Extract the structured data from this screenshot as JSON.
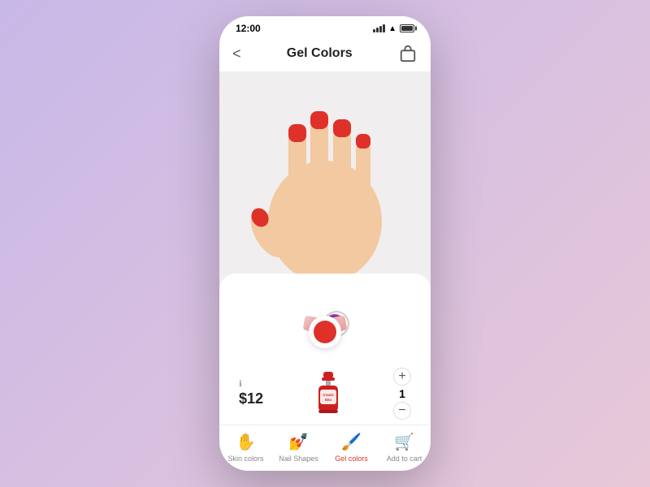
{
  "status": {
    "time": "12:00"
  },
  "header": {
    "title": "Gel Colors",
    "back_label": "<",
    "cart_label": "cart"
  },
  "hand": {
    "skin_color": "#f2c9a0",
    "nail_color": "#e0302a"
  },
  "palette": {
    "colors": [
      {
        "id": 1,
        "hex": "#ffd700",
        "label": "yellow"
      },
      {
        "id": 2,
        "hex": "#f5a623",
        "label": "orange-light"
      },
      {
        "id": 3,
        "hex": "#e55c1a",
        "label": "orange"
      },
      {
        "id": 4,
        "hex": "#e0302a",
        "label": "red",
        "selected": true
      },
      {
        "id": 5,
        "hex": "#cc2060",
        "label": "pink-dark"
      },
      {
        "id": 6,
        "hex": "#e040a0",
        "label": "magenta"
      },
      {
        "id": 7,
        "hex": "#9c27b0",
        "label": "purple"
      },
      {
        "id": 8,
        "hex": "#3f51b5",
        "label": "blue"
      },
      {
        "id": 9,
        "hex": "#fce4ec",
        "label": "glitter-light"
      },
      {
        "id": 10,
        "hex": "#f5c5c5",
        "label": "glitter-pink"
      }
    ],
    "selected_color": "#e0302a"
  },
  "product": {
    "price": "$12",
    "quantity": "1",
    "name": "Stars Red",
    "bottle_color": "#cc2020"
  },
  "bottom_nav": {
    "items": [
      {
        "id": "skin",
        "label": "Skin colors",
        "icon": "✋",
        "active": false
      },
      {
        "id": "shapes",
        "label": "Nail Shapes",
        "icon": "💅",
        "active": false
      },
      {
        "id": "gel",
        "label": "Gel colors",
        "icon": "🖌️",
        "active": true
      },
      {
        "id": "cart",
        "label": "Add to cart",
        "icon": "🛒",
        "active": false
      }
    ]
  }
}
